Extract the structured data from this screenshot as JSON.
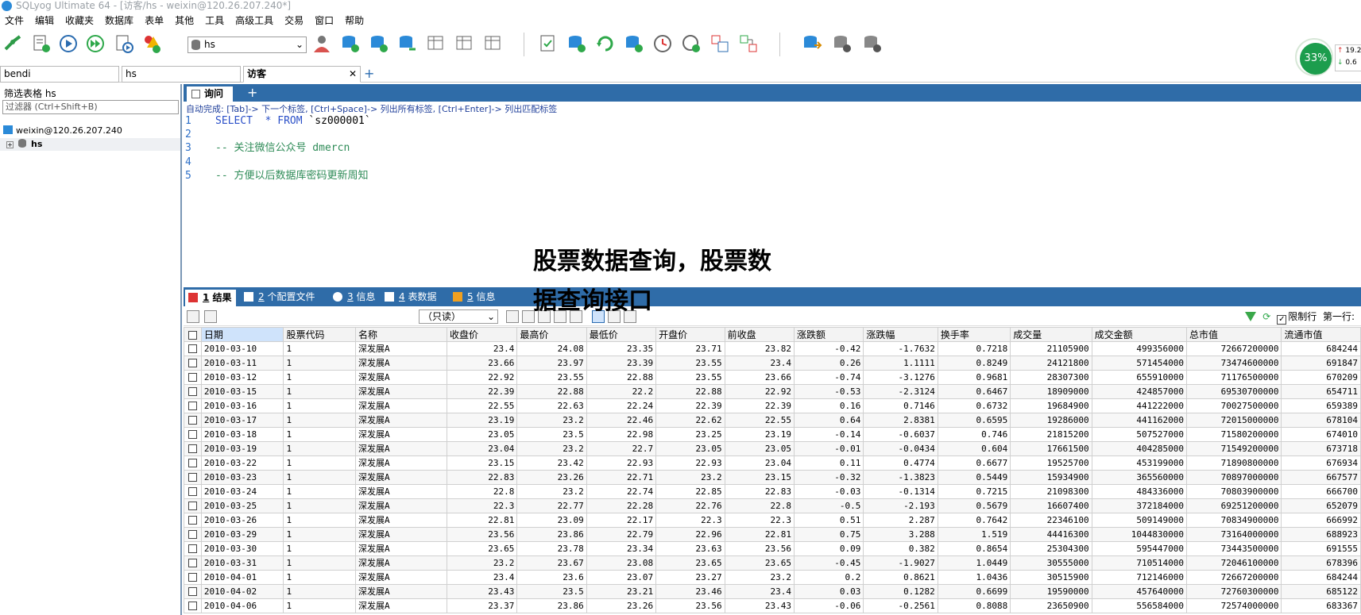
{
  "window": {
    "title": "SQLyog Ultimate 64 - [访客/hs - weixin@120.26.207.240*]"
  },
  "menu": [
    "文件",
    "编辑",
    "收藏夹",
    "数据库",
    "表单",
    "其他",
    "工具",
    "高级工具",
    "交易",
    "窗口",
    "帮助"
  ],
  "toolbar": {
    "database": "hs",
    "perf_percent": "33%",
    "perf_up": "19.2",
    "perf_down": "0.6"
  },
  "connection_tabs": [
    {
      "label": "bendi"
    },
    {
      "label": "hs"
    },
    {
      "label": "访客"
    }
  ],
  "left": {
    "filter_label": "筛选表格 hs",
    "filter_placeholder": "过滤器 (Ctrl+Shift+B)",
    "connection": "weixin@120.26.207.240",
    "database": "hs"
  },
  "query": {
    "tab_label": "询问",
    "hint": "自动完成: [Tab]-> 下一个标签, [Ctrl+Space]-> 列出所有标签, [Ctrl+Enter]-> 列出匹配标签",
    "lines": [
      {
        "num": "1",
        "kw1": "SELECT",
        "mid": "  * ",
        "kw2": "FROM",
        "rest": " `sz000001`"
      },
      {
        "num": "2",
        "comment": ""
      },
      {
        "num": "3",
        "comment": "-- 关注微信公众号 dmercn"
      },
      {
        "num": "4",
        "comment": ""
      },
      {
        "num": "5",
        "comment": "-- 方便以后数据库密码更新周知"
      }
    ]
  },
  "overlay": {
    "line1": "股票数据查询，股票数",
    "line2": "据查询接口"
  },
  "result_tabs": [
    {
      "num": "1",
      "label": " 结果"
    },
    {
      "num": "2",
      "label": " 个配置文件"
    },
    {
      "num": "3",
      "label": " 信息"
    },
    {
      "num": "4",
      "label": " 表数据"
    },
    {
      "num": "5",
      "label": " 信息"
    }
  ],
  "result_toolbar": {
    "readonly": "（只读）",
    "limit_label": "限制行",
    "first_row_label": "第一行:"
  },
  "columns": [
    "日期",
    "股票代码",
    "名称",
    "收盘价",
    "最高价",
    "最低价",
    "开盘价",
    "前收盘",
    "涨跌额",
    "涨跌幅",
    "换手率",
    "成交量",
    "成交金额",
    "总市值",
    "流通市值"
  ],
  "rows": [
    [
      "2010-03-10",
      "1",
      "深发展A",
      "23.4",
      "24.08",
      "23.35",
      "23.71",
      "23.82",
      "-0.42",
      "-1.7632",
      "0.7218",
      "21105900",
      "499356000",
      "72667200000",
      "684244"
    ],
    [
      "2010-03-11",
      "1",
      "深发展A",
      "23.66",
      "23.97",
      "23.39",
      "23.55",
      "23.4",
      "0.26",
      "1.1111",
      "0.8249",
      "24121800",
      "571454000",
      "73474600000",
      "691847"
    ],
    [
      "2010-03-12",
      "1",
      "深发展A",
      "22.92",
      "23.55",
      "22.88",
      "23.55",
      "23.66",
      "-0.74",
      "-3.1276",
      "0.9681",
      "28307300",
      "655910000",
      "71176500000",
      "670209"
    ],
    [
      "2010-03-15",
      "1",
      "深发展A",
      "22.39",
      "22.88",
      "22.2",
      "22.88",
      "22.92",
      "-0.53",
      "-2.3124",
      "0.6467",
      "18909000",
      "424857000",
      "69530700000",
      "654711"
    ],
    [
      "2010-03-16",
      "1",
      "深发展A",
      "22.55",
      "22.63",
      "22.24",
      "22.39",
      "22.39",
      "0.16",
      "0.7146",
      "0.6732",
      "19684900",
      "441222000",
      "70027500000",
      "659389"
    ],
    [
      "2010-03-17",
      "1",
      "深发展A",
      "23.19",
      "23.2",
      "22.46",
      "22.62",
      "22.55",
      "0.64",
      "2.8381",
      "0.6595",
      "19286000",
      "441162000",
      "72015000000",
      "678104"
    ],
    [
      "2010-03-18",
      "1",
      "深发展A",
      "23.05",
      "23.5",
      "22.98",
      "23.25",
      "23.19",
      "-0.14",
      "-0.6037",
      "0.746",
      "21815200",
      "507527000",
      "71580200000",
      "674010"
    ],
    [
      "2010-03-19",
      "1",
      "深发展A",
      "23.04",
      "23.2",
      "22.7",
      "23.05",
      "23.05",
      "-0.01",
      "-0.0434",
      "0.604",
      "17661500",
      "404285000",
      "71549200000",
      "673718"
    ],
    [
      "2010-03-22",
      "1",
      "深发展A",
      "23.15",
      "23.42",
      "22.93",
      "22.93",
      "23.04",
      "0.11",
      "0.4774",
      "0.6677",
      "19525700",
      "453199000",
      "71890800000",
      "676934"
    ],
    [
      "2010-03-23",
      "1",
      "深发展A",
      "22.83",
      "23.26",
      "22.71",
      "23.2",
      "23.15",
      "-0.32",
      "-1.3823",
      "0.5449",
      "15934900",
      "365560000",
      "70897000000",
      "667577"
    ],
    [
      "2010-03-24",
      "1",
      "深发展A",
      "22.8",
      "23.2",
      "22.74",
      "22.85",
      "22.83",
      "-0.03",
      "-0.1314",
      "0.7215",
      "21098300",
      "484336000",
      "70803900000",
      "666700"
    ],
    [
      "2010-03-25",
      "1",
      "深发展A",
      "22.3",
      "22.77",
      "22.28",
      "22.76",
      "22.8",
      "-0.5",
      "-2.193",
      "0.5679",
      "16607400",
      "372184000",
      "69251200000",
      "652079"
    ],
    [
      "2010-03-26",
      "1",
      "深发展A",
      "22.81",
      "23.09",
      "22.17",
      "22.3",
      "22.3",
      "0.51",
      "2.287",
      "0.7642",
      "22346100",
      "509149000",
      "70834900000",
      "666992"
    ],
    [
      "2010-03-29",
      "1",
      "深发展A",
      "23.56",
      "23.86",
      "22.79",
      "22.96",
      "22.81",
      "0.75",
      "3.288",
      "1.519",
      "44416300",
      "1044830000",
      "73164000000",
      "688923"
    ],
    [
      "2010-03-30",
      "1",
      "深发展A",
      "23.65",
      "23.78",
      "23.34",
      "23.63",
      "23.56",
      "0.09",
      "0.382",
      "0.8654",
      "25304300",
      "595447000",
      "73443500000",
      "691555"
    ],
    [
      "2010-03-31",
      "1",
      "深发展A",
      "23.2",
      "23.67",
      "23.08",
      "23.65",
      "23.65",
      "-0.45",
      "-1.9027",
      "1.0449",
      "30555000",
      "710514000",
      "72046100000",
      "678396"
    ],
    [
      "2010-04-01",
      "1",
      "深发展A",
      "23.4",
      "23.6",
      "23.07",
      "23.27",
      "23.2",
      "0.2",
      "0.8621",
      "1.0436",
      "30515900",
      "712146000",
      "72667200000",
      "684244"
    ],
    [
      "2010-04-02",
      "1",
      "深发展A",
      "23.43",
      "23.5",
      "23.21",
      "23.46",
      "23.4",
      "0.03",
      "0.1282",
      "0.6699",
      "19590000",
      "457640000",
      "72760300000",
      "685122"
    ],
    [
      "2010-04-06",
      "1",
      "深发展A",
      "23.37",
      "23.86",
      "23.26",
      "23.56",
      "23.43",
      "-0.06",
      "-0.2561",
      "0.8088",
      "23650900",
      "556584000",
      "72574000000",
      "683367"
    ]
  ]
}
